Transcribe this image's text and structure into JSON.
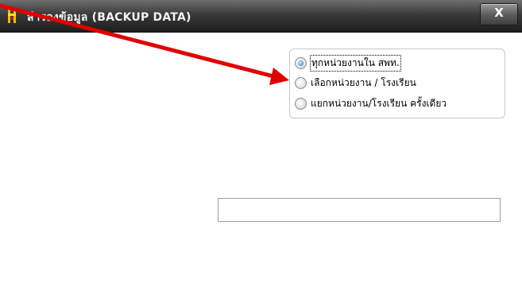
{
  "window": {
    "title": "สำรองข้อมูล (BACKUP DATA)",
    "app_icon": "backup-app-icon",
    "close_label": "X"
  },
  "options": {
    "items": [
      {
        "label": "ทุกหน่วยงานใน สพท.",
        "checked": true
      },
      {
        "label": "เลือกหน่วยงาน / โรงเรียน",
        "checked": false
      },
      {
        "label": "แยกหน่วยงาน/โรงเรียน ครั้งเดียว",
        "checked": false
      }
    ]
  },
  "path_field": {
    "value": ""
  },
  "annotation": {
    "arrow_color": "#e00000",
    "points_to": "option-select-unit"
  },
  "colors": {
    "titlebar_dark": "#1e1e1e",
    "titlebar_light": "#6e6e6e",
    "radio_selected": "#2a6fb8"
  }
}
